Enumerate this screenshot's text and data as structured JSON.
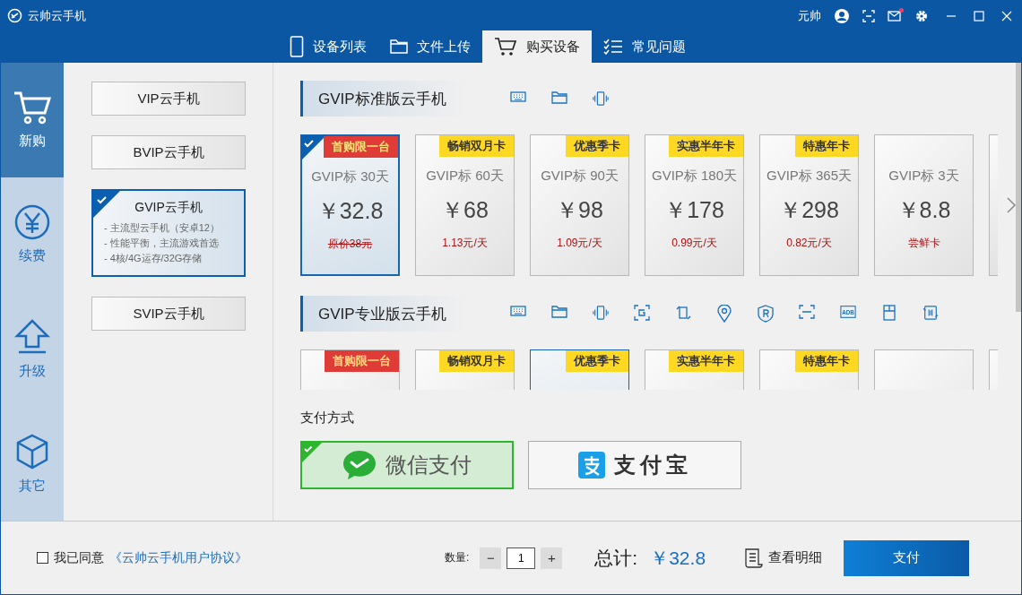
{
  "window": {
    "title": "云帅云手机",
    "user": "元帅",
    "unread": true
  },
  "tabs": [
    {
      "label": "设备列表",
      "selected": false
    },
    {
      "label": "文件上传",
      "selected": false
    },
    {
      "label": "购买设备",
      "selected": true
    },
    {
      "label": "常见问题",
      "selected": false
    }
  ],
  "nav": [
    {
      "label": "新购",
      "selected": true
    },
    {
      "label": "续费",
      "selected": false
    },
    {
      "label": "升级",
      "selected": false
    },
    {
      "label": "其它",
      "selected": false
    }
  ],
  "plans": [
    {
      "name": "VIP云手机",
      "selected": false
    },
    {
      "name": "BVIP云手机",
      "selected": false
    },
    {
      "name": "GVIP云手机",
      "selected": true,
      "features": [
        "- 主流型云手机（安卓12）",
        "- 性能平衡，主流游戏首选",
        "- 4核/4G运存/32G存储"
      ]
    },
    {
      "name": "SVIP云手机",
      "selected": false
    }
  ],
  "sections": [
    {
      "title": "GVIP标准版云手机",
      "features": [
        {
          "kind": "keyboard"
        },
        {
          "kind": "folder"
        },
        {
          "kind": "shake"
        }
      ],
      "cards": [
        {
          "tag": {
            "text": "首购限一台",
            "kind": "first"
          },
          "name": "GVIP标 30天",
          "price": "￥32.8",
          "note": {
            "text": "原价38元",
            "kind": "original"
          },
          "selected": true
        },
        {
          "tag": {
            "text": "畅销双月卡",
            "kind": "promo"
          },
          "name": "GVIP标 60天",
          "price": "￥68",
          "note": {
            "text": "1.13元/天",
            "kind": "daily"
          },
          "selected": false
        },
        {
          "tag": {
            "text": "优惠季卡",
            "kind": "promo"
          },
          "name": "GVIP标 90天",
          "price": "￥98",
          "note": {
            "text": "1.09元/天",
            "kind": "daily"
          },
          "selected": false
        },
        {
          "tag": {
            "text": "实惠半年卡",
            "kind": "promo"
          },
          "name": "GVIP标 180天",
          "price": "￥178",
          "note": {
            "text": "0.99元/天",
            "kind": "daily"
          },
          "selected": false
        },
        {
          "tag": {
            "text": "特惠年卡",
            "kind": "promo"
          },
          "name": "GVIP标 365天",
          "price": "￥298",
          "note": {
            "text": "0.82元/天",
            "kind": "daily"
          },
          "selected": false
        },
        {
          "name": "GVIP标 3天",
          "price": "￥8.8",
          "note": {
            "text": "尝鲜卡",
            "kind": "daily"
          },
          "selected": false
        }
      ]
    },
    {
      "title": "GVIP专业版云手机",
      "features": [
        {
          "kind": "keyboard"
        },
        {
          "kind": "folder"
        },
        {
          "kind": "shake"
        },
        {
          "kind": "screenshot"
        },
        {
          "kind": "rotate"
        },
        {
          "kind": "location"
        },
        {
          "kind": "root"
        },
        {
          "kind": "scan"
        },
        {
          "kind": "adb",
          "label": "ADB"
        },
        {
          "kind": "clipboard"
        },
        {
          "kind": "swap"
        }
      ],
      "cards": [
        {
          "tag": {
            "text": "首购限一台",
            "kind": "first"
          },
          "selected": false
        },
        {
          "tag": {
            "text": "畅销双月卡",
            "kind": "promo"
          },
          "selected": false
        },
        {
          "tag": {
            "text": "优惠季卡",
            "kind": "promo"
          },
          "selected": true
        },
        {
          "tag": {
            "text": "实惠半年卡",
            "kind": "promo"
          },
          "selected": false
        },
        {
          "tag": {
            "text": "特惠年卡",
            "kind": "promo"
          },
          "selected": false
        },
        {
          "selected": false
        }
      ]
    }
  ],
  "payment": {
    "label": "支付方式",
    "methods": [
      {
        "kind": "wechat",
        "label": "微信支付",
        "selected": true
      },
      {
        "kind": "alipay",
        "label": "支付宝",
        "selected": false
      }
    ]
  },
  "footer": {
    "agree": {
      "checked": false,
      "label": "我已同意",
      "link": "《云帅云手机用户协议》"
    },
    "quantity": {
      "label": "数量:",
      "minus": "−",
      "value": "1",
      "plus": "+"
    },
    "total": {
      "label": "总计:",
      "value": "￥32.8"
    },
    "details": "查看明细",
    "pay": "支付"
  }
}
